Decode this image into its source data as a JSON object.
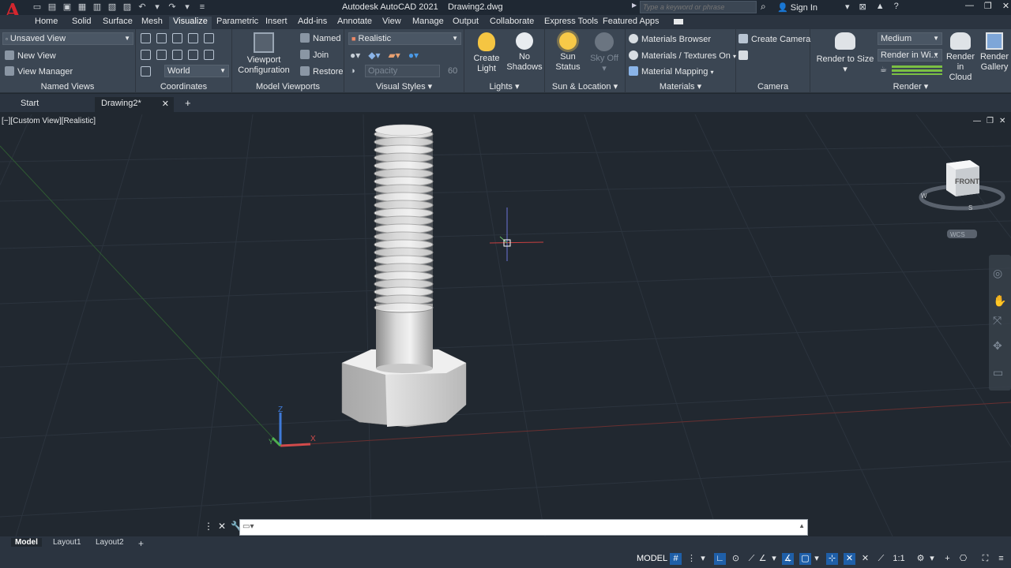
{
  "app": {
    "logo": "A",
    "title": "Autodesk AutoCAD 2021",
    "filename": "Drawing2.dwg",
    "search_placeholder": "Type a keyword or phrase",
    "signin": "Sign In"
  },
  "tabs": [
    "Home",
    "Solid",
    "Surface",
    "Mesh",
    "Visualize",
    "Parametric",
    "Insert",
    "Add-ins",
    "Annotate",
    "View",
    "Manage",
    "Output",
    "Collaborate",
    "Express Tools",
    "Featured Apps"
  ],
  "active_tab": "Visualize",
  "ribbon": {
    "named_views": {
      "dropdown": "Unsaved View",
      "new_view": "New View",
      "view_manager": "View Manager",
      "title": "Named Views"
    },
    "coordinates": {
      "ucs": "World",
      "title": "Coordinates"
    },
    "model_viewports": {
      "config_line1": "Viewport",
      "config_line2": "Configuration",
      "named": "Named",
      "join": "Join",
      "restore": "Restore",
      "title": "Model Viewports"
    },
    "visual_styles": {
      "dropdown": "Realistic",
      "opacity_label": "Opacity",
      "opacity_value": "60",
      "title": "Visual Styles"
    },
    "lights": {
      "create_light_line1": "Create",
      "create_light_line2": "Light",
      "no_shadows_line1": "No",
      "no_shadows_line2": "Shadows",
      "title": "Lights"
    },
    "sun_location": {
      "sun_status_line1": "Sun",
      "sun_status_line2": "Status",
      "sky_off": "Sky Off",
      "title": "Sun & Location"
    },
    "materials": {
      "browser": "Materials Browser",
      "textures": "Materials / Textures On",
      "mapping": "Material Mapping",
      "title": "Materials"
    },
    "camera": {
      "create_camera": "Create Camera",
      "title": "Camera"
    },
    "render": {
      "render_to_size": "Render to Size",
      "quality": "Medium",
      "render_in": "Render in Wi...",
      "cloud_line1": "Render in",
      "cloud_line2": "Cloud",
      "gallery_line1": "Render",
      "gallery_line2": "Gallery",
      "title": "Render"
    }
  },
  "file_tabs": [
    "Start",
    "Drawing2*"
  ],
  "viewport": {
    "label": "[−][Custom View][Realistic]",
    "viewcube_face": "FRONT",
    "compass_w": "W",
    "compass_s": "S",
    "wcs": "WCS",
    "axis_z": "Z",
    "axis_x": "X",
    "axis_y": "Y"
  },
  "command_line": {
    "value": ""
  },
  "layout_tabs": [
    "Model",
    "Layout1",
    "Layout2"
  ],
  "status": {
    "model": "MODEL",
    "scale": "1:1"
  },
  "colors": {
    "accent": "#1f5fa8",
    "ribbon_bg": "#3b4653",
    "viewport_bg": "#212830",
    "logo": "#d3262e"
  }
}
